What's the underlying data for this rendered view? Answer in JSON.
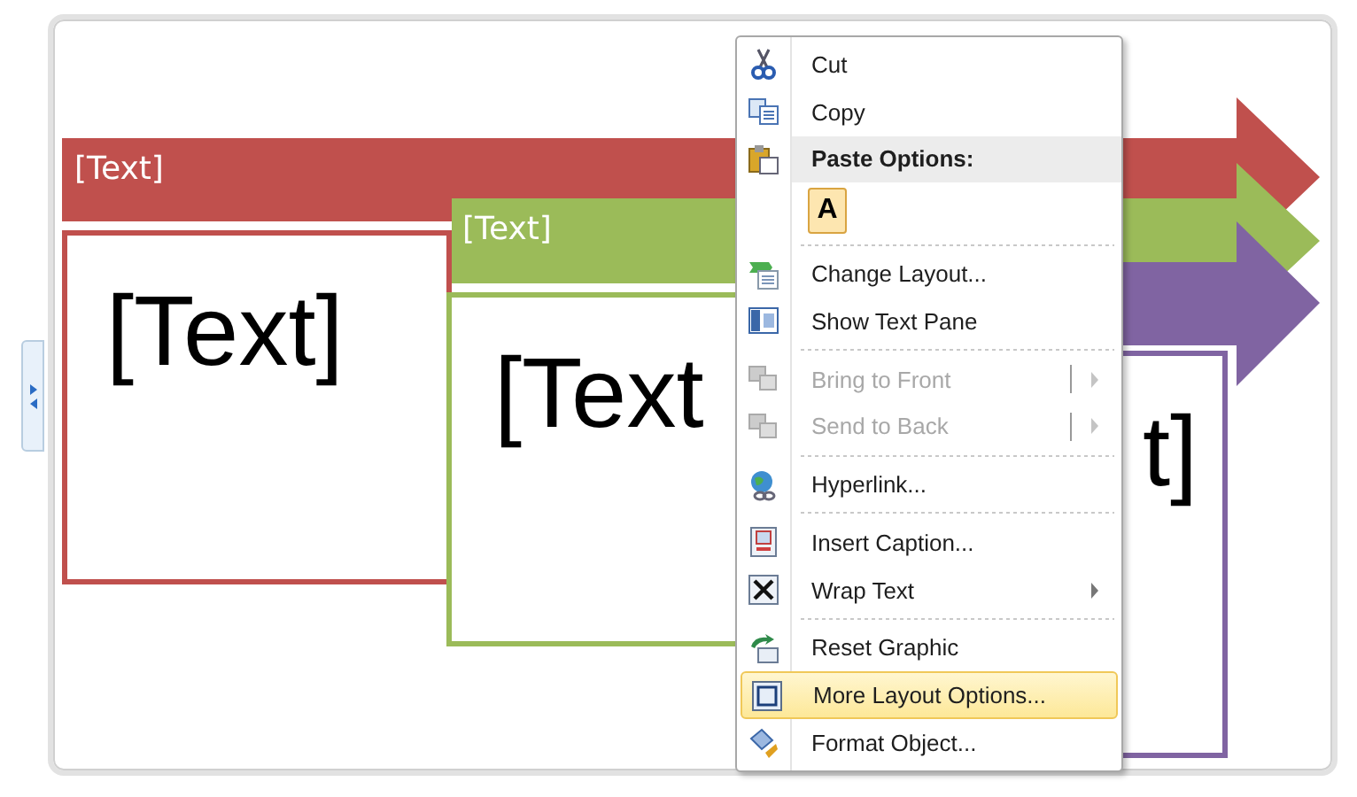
{
  "diagram": {
    "rows": [
      {
        "color": "#c0504d",
        "header": "[Text]",
        "body": "[Text]"
      },
      {
        "color": "#9bbb59",
        "header": "[Text]",
        "body": "[Text"
      },
      {
        "color": "#8064a2",
        "body": "t]"
      }
    ]
  },
  "context_menu": {
    "items": [
      {
        "kind": "command",
        "label": "Cut",
        "disabled": false,
        "selected": false,
        "submenu": false,
        "split": false
      },
      {
        "kind": "command",
        "label": "Copy",
        "disabled": false,
        "selected": false,
        "submenu": false,
        "split": false
      },
      {
        "kind": "header",
        "label": "Paste Options:"
      },
      {
        "kind": "paste_option",
        "label": "A"
      },
      {
        "kind": "separator"
      },
      {
        "kind": "command",
        "label": "Change Layout...",
        "disabled": false,
        "selected": false,
        "submenu": false,
        "split": false
      },
      {
        "kind": "command",
        "label": "Show Text Pane",
        "disabled": false,
        "selected": false,
        "submenu": false,
        "split": false
      },
      {
        "kind": "separator"
      },
      {
        "kind": "command",
        "label": "Bring to Front",
        "disabled": true,
        "selected": false,
        "submenu": true,
        "split": true
      },
      {
        "kind": "command",
        "label": "Send to Back",
        "disabled": true,
        "selected": false,
        "submenu": true,
        "split": true
      },
      {
        "kind": "separator"
      },
      {
        "kind": "command",
        "label": "Hyperlink...",
        "disabled": false,
        "selected": false,
        "submenu": false,
        "split": false
      },
      {
        "kind": "separator"
      },
      {
        "kind": "command",
        "label": "Insert Caption...",
        "disabled": false,
        "selected": false,
        "submenu": false,
        "split": false
      },
      {
        "kind": "command",
        "label": "Wrap Text",
        "disabled": false,
        "selected": false,
        "submenu": true,
        "split": false
      },
      {
        "kind": "separator"
      },
      {
        "kind": "command",
        "label": "Reset Graphic",
        "disabled": false,
        "selected": false,
        "submenu": false,
        "split": false
      },
      {
        "kind": "command",
        "label": "More Layout Options...",
        "disabled": false,
        "selected": true,
        "submenu": false,
        "split": false
      },
      {
        "kind": "command",
        "label": "Format Object...",
        "disabled": false,
        "selected": false,
        "submenu": false,
        "split": false
      }
    ]
  }
}
